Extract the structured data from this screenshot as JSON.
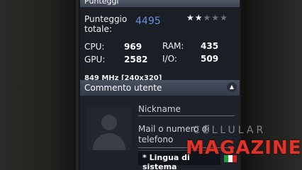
{
  "header": {
    "title": "Punteggi"
  },
  "score": {
    "label": "Punteggio totale:",
    "value": "4495",
    "rating_filled": 2,
    "rating_total": 5,
    "star_on_color": "#f2f2f2",
    "star_off_color": "#6f7378"
  },
  "metrics": {
    "cpu_label": "CPU:",
    "cpu_value": "969",
    "ram_label": "RAM:",
    "ram_value": "435",
    "gpu_label": "GPU:",
    "gpu_value": "2582",
    "io_label": "I/O:",
    "io_value": "509"
  },
  "device_info": "849 MHz [240x320]",
  "comment_section": {
    "title": "Commento utente",
    "toggle_icon": "chevron-up-icon",
    "nickname_placeholder": "Nickname",
    "contact_placeholder_line1": "Mail o numero di",
    "contact_placeholder_line2": "telefono",
    "language_button": "* Lingua di sistema",
    "avatar_icon": "person-silhouette-icon",
    "flag_icon": "italy-flag-icon"
  },
  "watermark": {
    "top": "CELLULAR",
    "main": "MAGAZINE"
  },
  "colors": {
    "accent": "#6d8fe0",
    "flag": [
      "#1f9a3d",
      "#ffffff",
      "#d0262a"
    ]
  }
}
